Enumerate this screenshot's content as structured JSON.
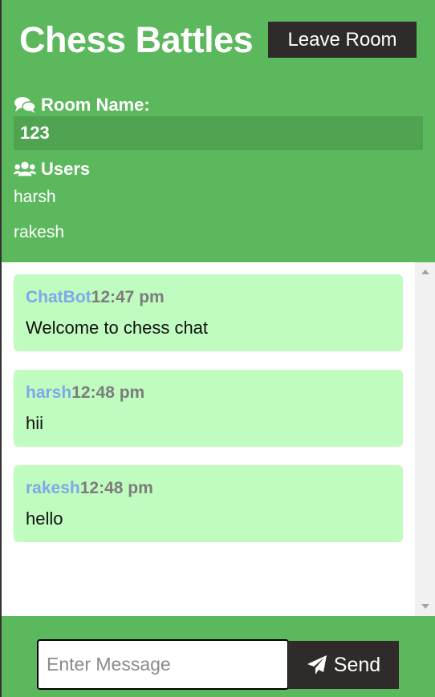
{
  "header": {
    "title": "Chess Battles",
    "leave_label": "Leave Room"
  },
  "sidebar": {
    "room_heading": "Room Name:",
    "room_icon": "comments-icon",
    "room_name": "123",
    "users_heading": "Users",
    "users_icon": "users-icon",
    "users": [
      "harsh",
      "rakesh"
    ]
  },
  "messages": [
    {
      "user": "ChatBot",
      "time": "12:47 pm",
      "text": "Welcome to chess chat"
    },
    {
      "user": "harsh",
      "time": "12:48 pm",
      "text": "hii"
    },
    {
      "user": "rakesh",
      "time": "12:48 pm",
      "text": "hello"
    }
  ],
  "form": {
    "placeholder": "Enter Message",
    "value": "",
    "send_label": "Send",
    "send_icon": "paper-plane-icon"
  },
  "colors": {
    "primary_green": "#5cb85c",
    "dark_button": "#2f2b2a",
    "message_bg": "#c0fbbf",
    "username": "#7fa8ea",
    "time": "#7c7c7c"
  }
}
